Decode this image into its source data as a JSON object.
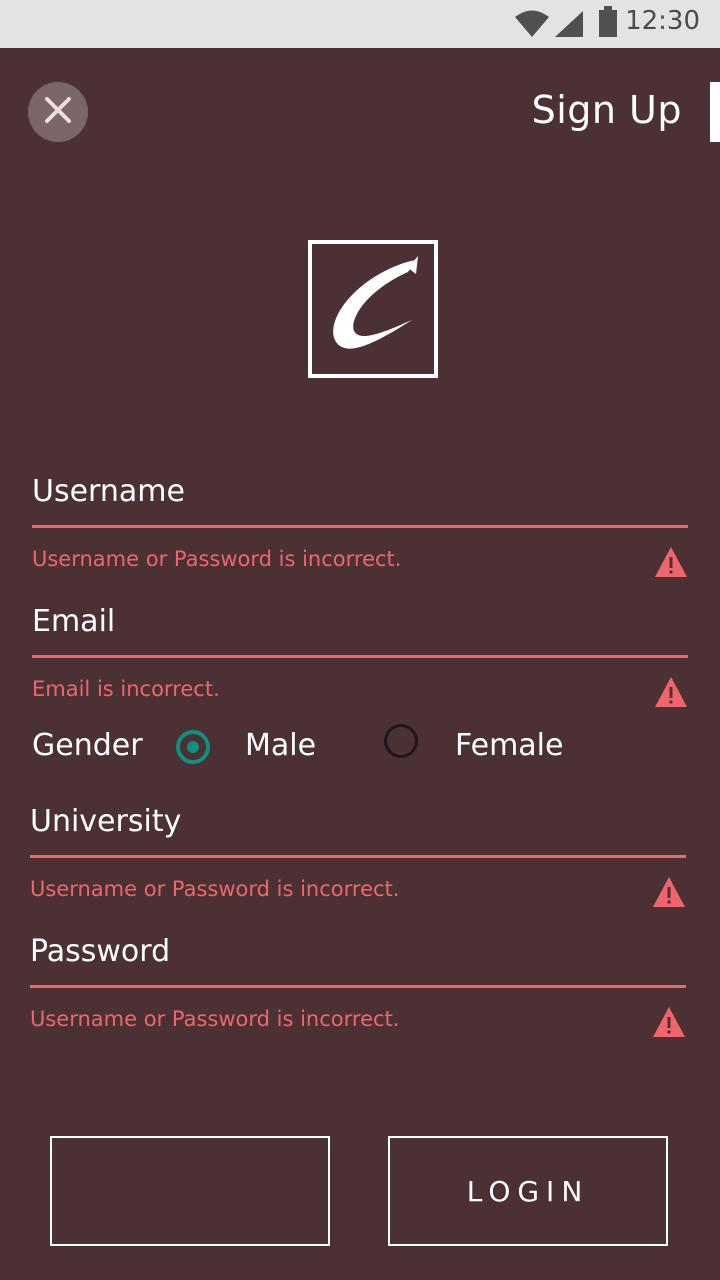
{
  "status_bar": {
    "time": "12:30",
    "icons": [
      "wifi-icon",
      "signal-icon",
      "battery-icon"
    ]
  },
  "header": {
    "title": "Sign Up",
    "close_icon": "close-icon"
  },
  "logo": {
    "name": "brand-logo"
  },
  "form": {
    "username": {
      "label": "Username",
      "error": "Username or Password is incorrect."
    },
    "email": {
      "label": "Email",
      "error": "Email is incorrect."
    },
    "gender": {
      "label": "Gender",
      "options": [
        {
          "label": "Male",
          "selected": true
        },
        {
          "label": "Female",
          "selected": false
        }
      ]
    },
    "university": {
      "label": "University",
      "error": "Username or Password is incorrect."
    },
    "password": {
      "label": "Password",
      "error": "Username or Password is incorrect."
    }
  },
  "buttons": {
    "left_label": "",
    "login_label": "LOGIN"
  },
  "colors": {
    "background": "#4b3134",
    "error": "#f0656b",
    "accent": "#0f8f80",
    "status_bar": "#e3e3e3"
  }
}
